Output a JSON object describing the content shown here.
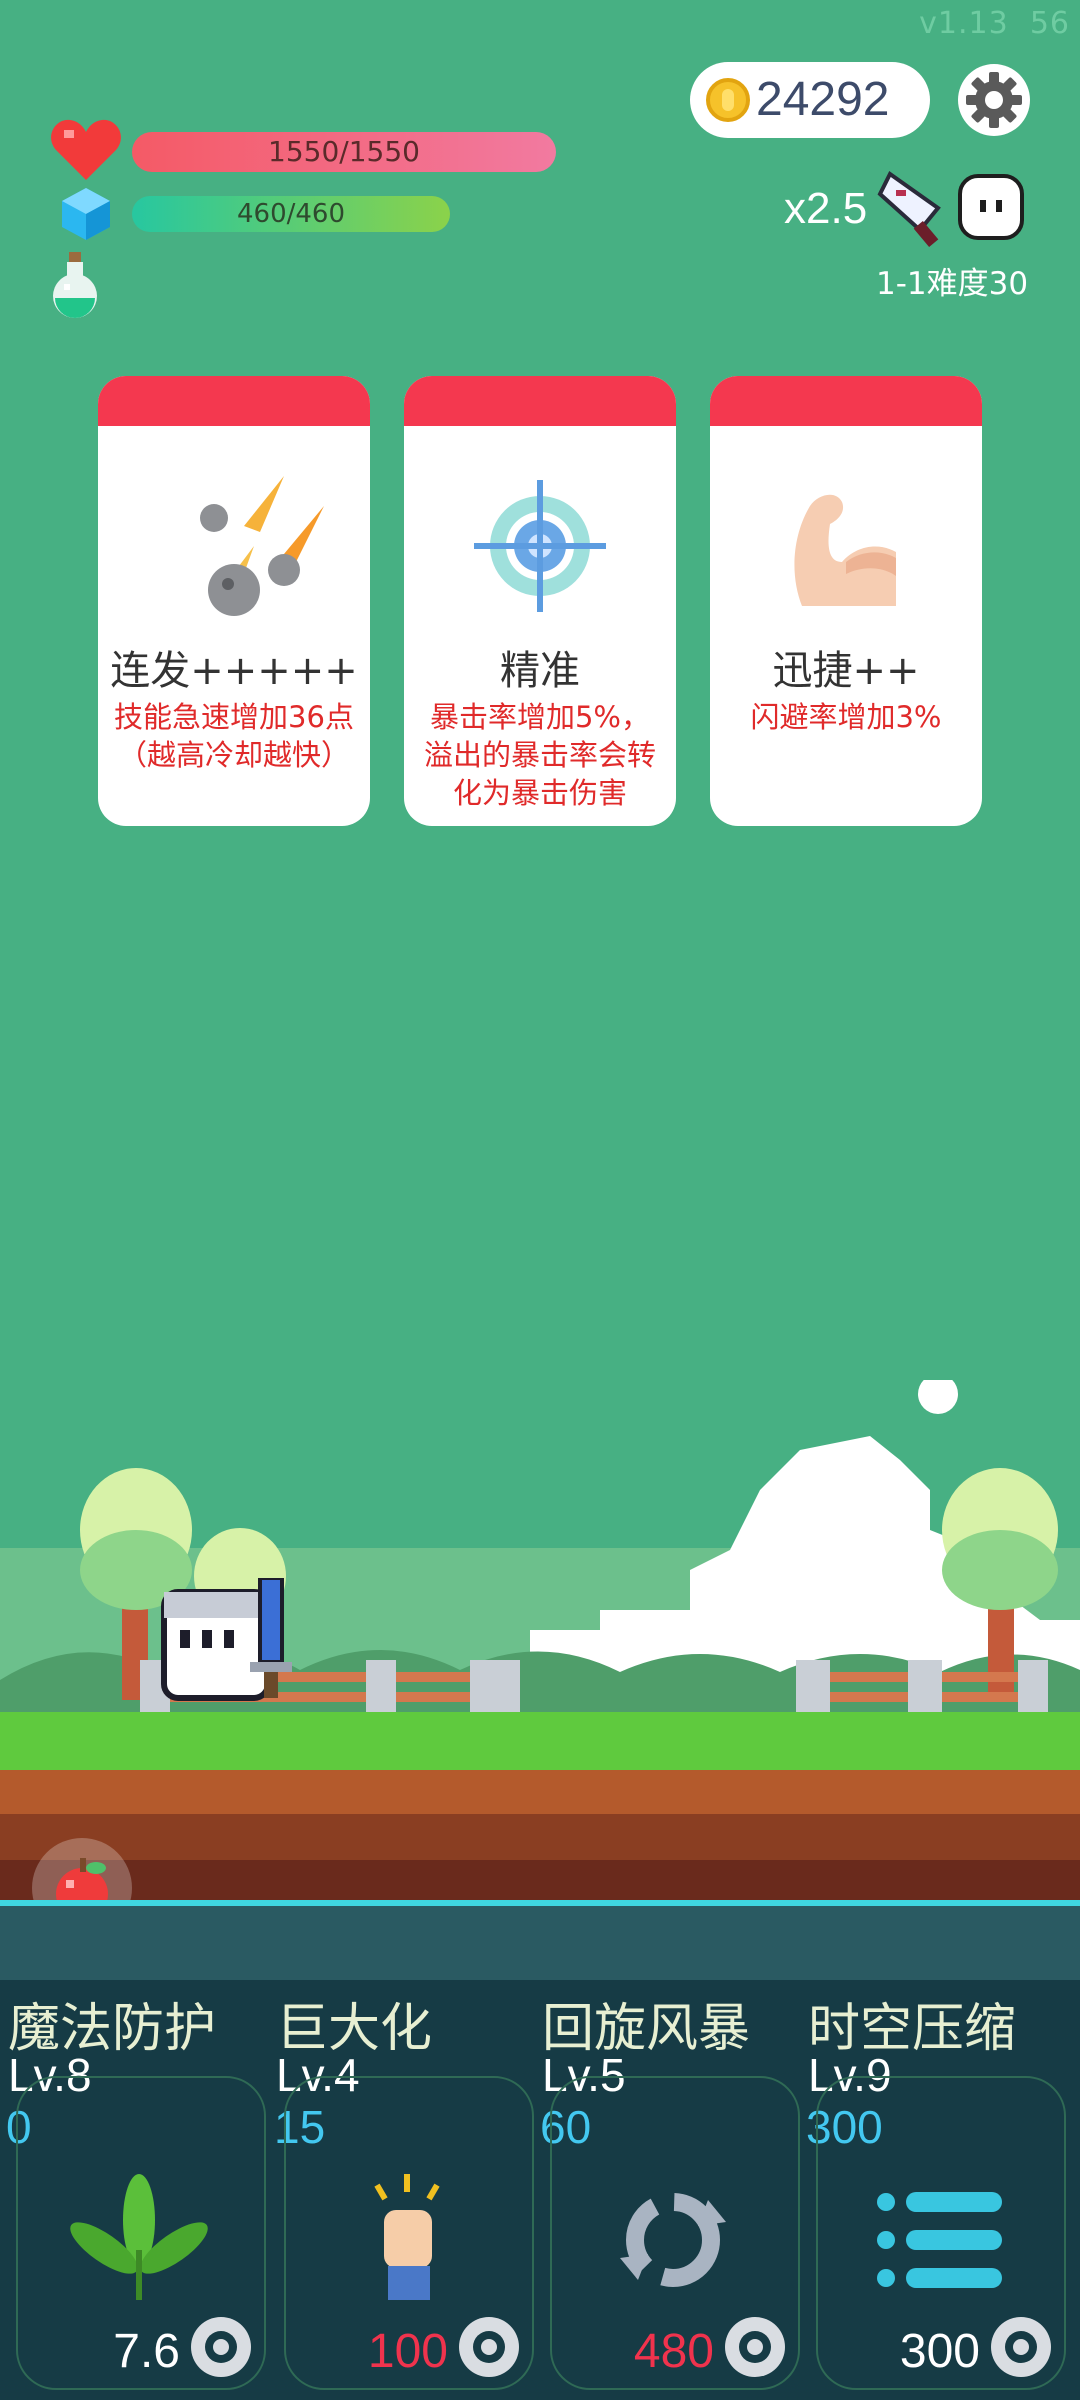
{
  "version": "v1.13",
  "fps": "56",
  "coins": "24292",
  "hp": {
    "text": "1550/1550",
    "fill": 1.0
  },
  "mp": {
    "text": "460/460",
    "fill": 1.0
  },
  "multiplier": "x2.5",
  "stage": "1-1难度30",
  "cards": [
    {
      "title": "连发+++++",
      "desc": "技能急速增加36点（越高冷却越快）",
      "icon": "meteor-icon"
    },
    {
      "title": "精准",
      "desc": "暴击率增加5%，溢出的暴击率会转化为暴击伤害",
      "icon": "crosshair-icon"
    },
    {
      "title": "迅捷++",
      "desc": "闪避率增加3%",
      "icon": "muscle-arm-icon"
    }
  ],
  "skills": [
    {
      "name": "魔法防护",
      "level": "Lv.8",
      "cost": "0",
      "cooldown": "7.6",
      "cooldown_color": "#ffffff",
      "icon": "leaf-icon"
    },
    {
      "name": "巨大化",
      "level": "Lv.4",
      "cost": "15",
      "cooldown": "100",
      "cooldown_color": "#f0334d",
      "icon": "raised-fist-icon"
    },
    {
      "name": "回旋风暴",
      "level": "Lv.5",
      "cost": "60",
      "cooldown": "480",
      "cooldown_color": "#f0334d",
      "icon": "spin-arrows-icon"
    },
    {
      "name": "时空压缩",
      "level": "Lv.9",
      "cost": "300",
      "cooldown": "300",
      "cooldown_color": "#ffffff",
      "icon": "list-icon"
    }
  ],
  "colors": {
    "background": "#47b083",
    "card_header": "#f4384f",
    "card_desc": "#e02a2a",
    "cost": "#43c8f0"
  }
}
